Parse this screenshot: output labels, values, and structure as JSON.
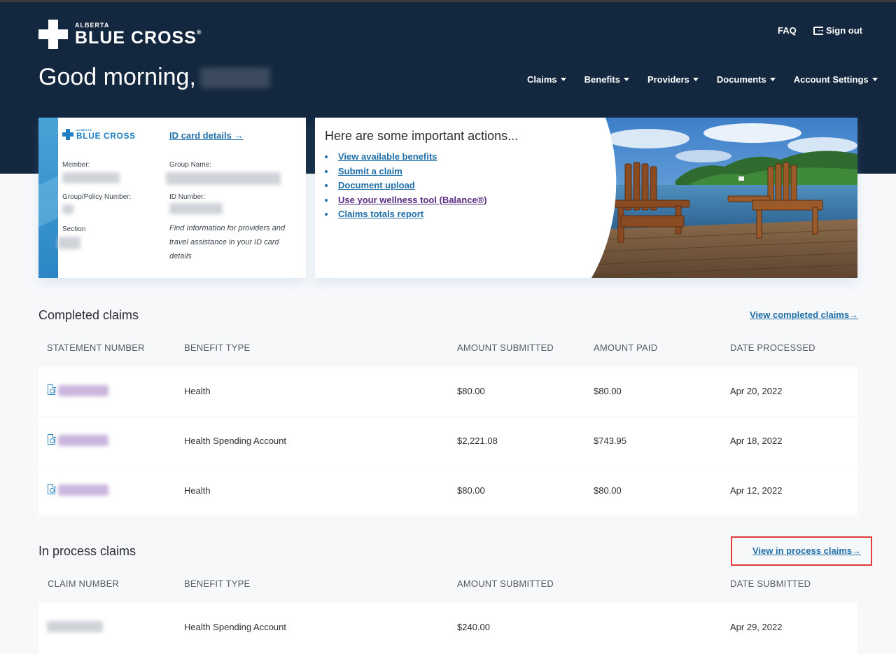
{
  "header": {
    "logo_small": "ALBERTA",
    "logo_big": "BLUE CROSS",
    "logo_reg": "®",
    "faq": "FAQ",
    "sign_out": "Sign out",
    "greeting": "Good morning,",
    "nav": [
      "Claims",
      "Benefits",
      "Providers",
      "Documents",
      "Account Settings"
    ]
  },
  "id_card": {
    "logo_small": "ALBERTA",
    "logo_big": "BLUE CROSS",
    "details_link": "ID card details",
    "member_label": "Member:",
    "group_name_label": "Group Name:",
    "group_policy_label": "Group/Policy Number:",
    "id_number_label": "ID Number:",
    "section_label": "Section",
    "note": "Find Information for providers and travel assistance in your ID card details"
  },
  "actions": {
    "title": "Here are some important actions...",
    "links": [
      "View available benefits",
      "Submit a claim",
      "Document upload",
      "Use your wellness tool (Balance®)",
      "Claims totals report"
    ]
  },
  "completed_claims": {
    "title": "Completed claims",
    "view_link": "View completed claims",
    "headers": [
      "STATEMENT NUMBER",
      "BENEFIT TYPE",
      "AMOUNT SUBMITTED",
      "AMOUNT PAID",
      "DATE PROCESSED"
    ],
    "rows": [
      {
        "benefit": "Health",
        "submitted": "$80.00",
        "paid": "$80.00",
        "date": "Apr 20, 2022"
      },
      {
        "benefit": "Health Spending Account",
        "submitted": "$2,221.08",
        "paid": "$743.95",
        "date": "Apr 18, 2022"
      },
      {
        "benefit": "Health",
        "submitted": "$80.00",
        "paid": "$80.00",
        "date": "Apr 12, 2022"
      }
    ]
  },
  "in_process_claims": {
    "title": "In process claims",
    "view_link": "View in process claims",
    "headers": [
      "CLAIM NUMBER",
      "BENEFIT TYPE",
      "AMOUNT SUBMITTED",
      "DATE SUBMITTED"
    ],
    "rows": [
      {
        "benefit": "Health Spending Account",
        "submitted": "$240.00",
        "date": "Apr 29, 2022"
      }
    ]
  },
  "colors": {
    "header_bg": "#13273f",
    "link": "#1f6fa8",
    "brand_blue": "#1f7fc2",
    "highlight": "#e23b3b"
  }
}
